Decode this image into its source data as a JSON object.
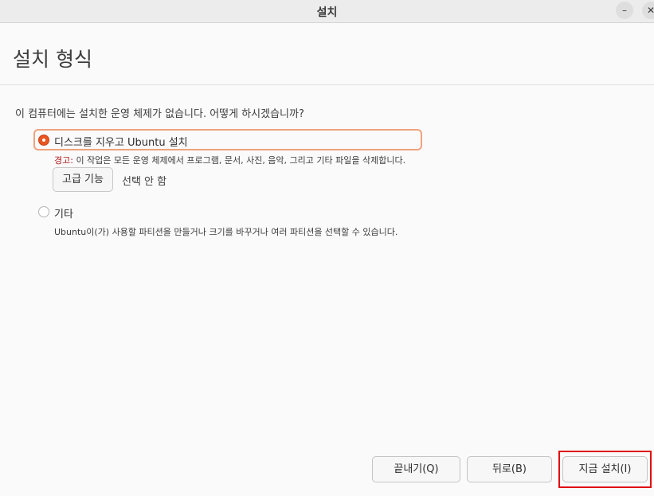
{
  "window": {
    "title": "설치",
    "minimize_glyph": "–",
    "close_glyph": "✕"
  },
  "header": {
    "title": "설치 형식"
  },
  "main": {
    "question": "이 컴퓨터에는 설치한 운영 체제가 없습니다. 어떻게 하시겠습니까?",
    "options": [
      {
        "label": "디스크를 지우고 Ubuntu 설치",
        "selected": true,
        "warning_label": "경고:",
        "warning_text": " 이 작업은 모든 운영 체제에서 프로그램, 문서, 사진, 음악, 그리고 기타 파일을 삭제합니다.",
        "advanced_button": "고급 기능",
        "advanced_status": "선택 안 함"
      },
      {
        "label": "기타",
        "selected": false,
        "description": "Ubuntu이(가) 사용할 파티션을 만들거나 크기를 바꾸거나 여러 파티션을 선택할 수 있습니다."
      }
    ]
  },
  "footer": {
    "quit_label": "끝내기(Q)",
    "back_label": "뒤로(B)",
    "install_label": "지금 설치(I)"
  },
  "colors": {
    "accent": "#e95420",
    "highlight": "#e01010",
    "warning": "#b01818"
  }
}
